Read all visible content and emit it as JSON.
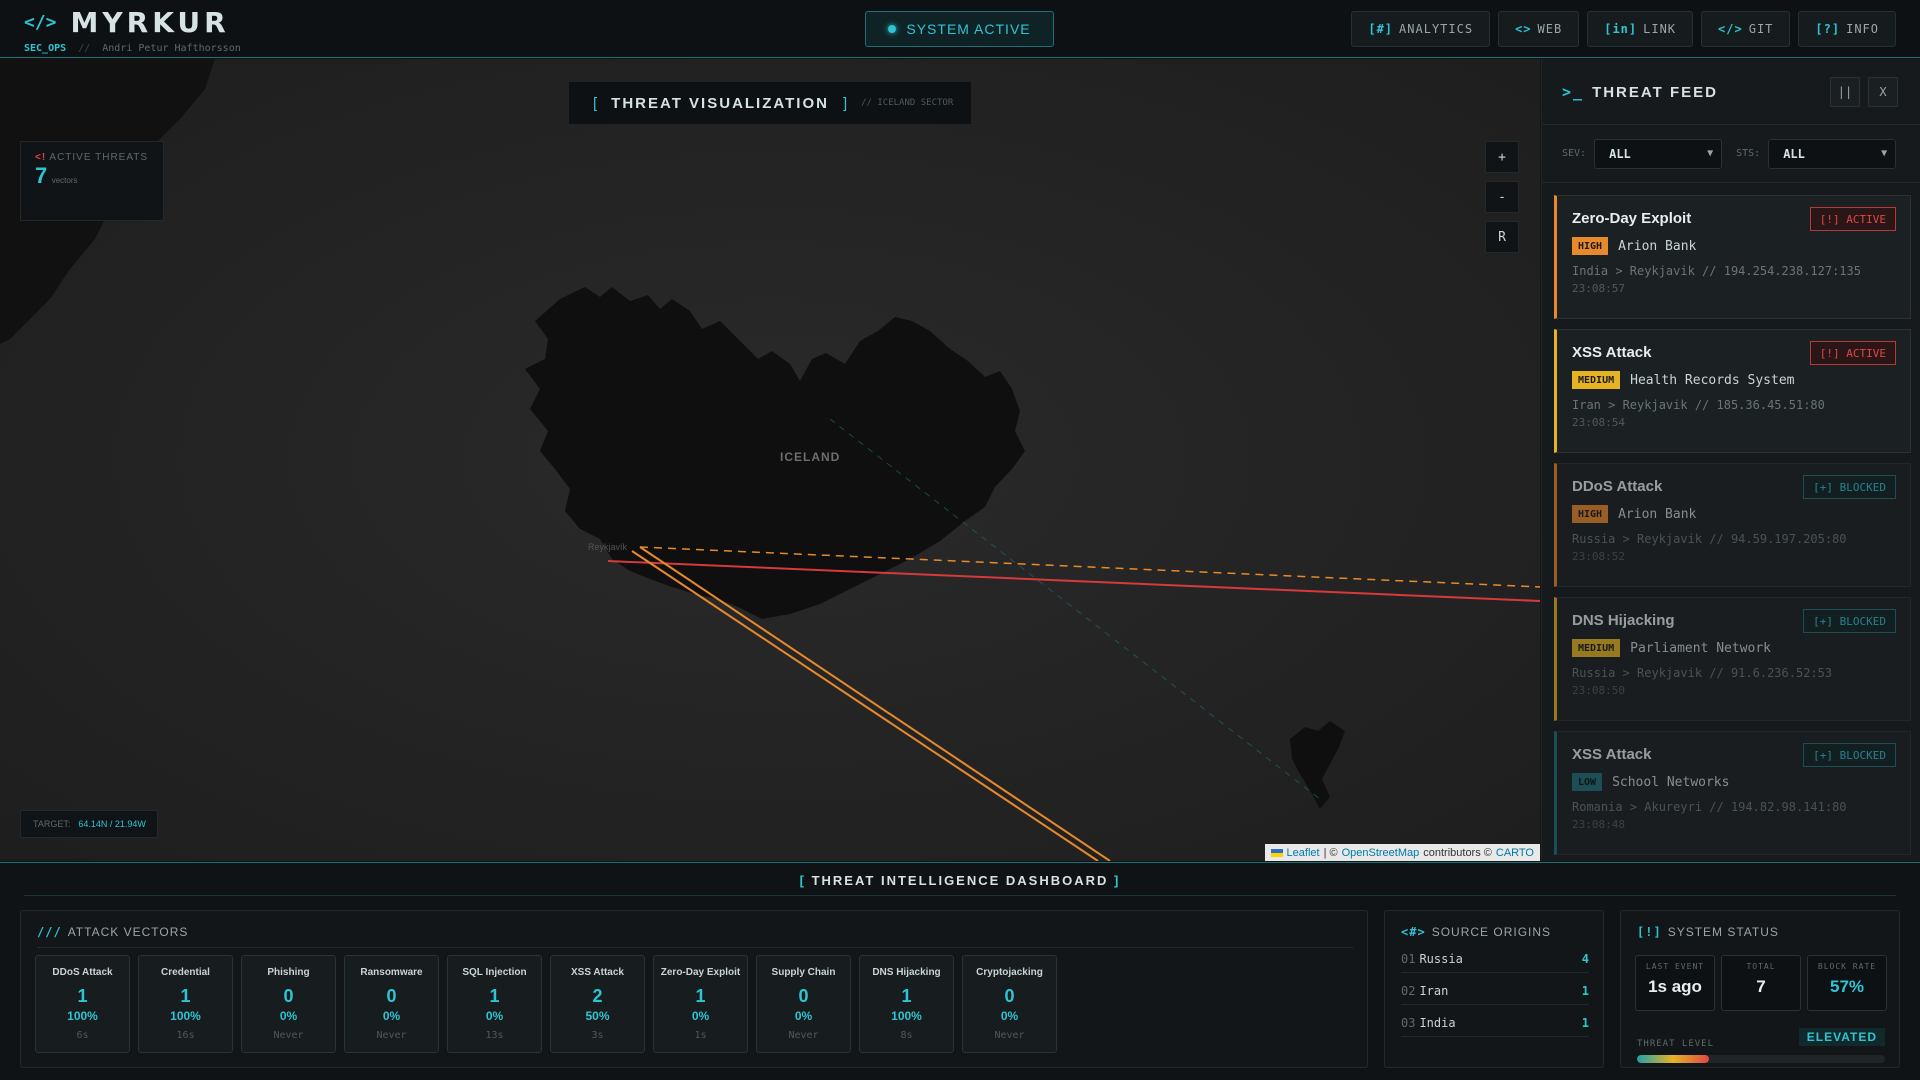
{
  "header": {
    "brand_icon": "</>",
    "brand_name": "MYRKUR",
    "sub_ops": "SEC_OPS",
    "sub_sep": "//",
    "sub_author": "Andri Petur Hafthorsson",
    "status_label": "SYSTEM ACTIVE",
    "nav": [
      {
        "icon": "[#]",
        "label": "ANALYTICS"
      },
      {
        "icon": "<>",
        "label": "WEB"
      },
      {
        "icon": "[in]",
        "label": "LINK"
      },
      {
        "icon": "</>",
        "label": "GIT"
      },
      {
        "icon": "[?]",
        "label": "INFO"
      }
    ]
  },
  "map": {
    "title_left_bracket": "[",
    "title": "THREAT VISUALIZATION",
    "title_right_bracket": "]",
    "title_sub": "// ICELAND SECTOR",
    "active_threats_icon": "<!",
    "active_threats_label": "ACTIVE THREATS",
    "active_threats_value": "7",
    "active_threats_unit": "vectors",
    "zoom_in": "+",
    "zoom_out": "-",
    "reset": "R",
    "target_label": "TARGET:",
    "target_value": "64.14N / 21.94W",
    "country_label": "ICELAND",
    "city_label": "Reykjavík",
    "attribution": {
      "leaflet": "Leaflet",
      "sep": "| ©",
      "osm": "OpenStreetMap",
      "contrib": "contributors ©",
      "carto": "CARTO"
    }
  },
  "feed": {
    "prompt": ">_",
    "title": "THREAT FEED",
    "pause": "||",
    "close": "X",
    "sev_label": "SEV:",
    "sev_value": "ALL",
    "sts_label": "STS:",
    "sts_value": "ALL",
    "items": [
      {
        "title": "Zero-Day Exploit",
        "status": "[!] ACTIVE",
        "severity": "HIGH",
        "target": "Arion Bank",
        "route": "India > Reykjavik // 194.254.238.127:135",
        "time": "23:08:57"
      },
      {
        "title": "XSS Attack",
        "status": "[!] ACTIVE",
        "severity": "MEDIUM",
        "target": "Health Records System",
        "route": "Iran > Reykjavik // 185.36.45.51:80",
        "time": "23:08:54"
      },
      {
        "title": "DDoS Attack",
        "status": "[+] BLOCKED",
        "severity": "HIGH",
        "target": "Arion Bank",
        "route": "Russia > Reykjavik // 94.59.197.205:80",
        "time": "23:08:52"
      },
      {
        "title": "DNS Hijacking",
        "status": "[+] BLOCKED",
        "severity": "MEDIUM",
        "target": "Parliament Network",
        "route": "Russia > Reykjavik // 91.6.236.52:53",
        "time": "23:08:50"
      },
      {
        "title": "XSS Attack",
        "status": "[+] BLOCKED",
        "severity": "LOW",
        "target": "School Networks",
        "route": "Romania > Akureyri // 194.82.98.141:80",
        "time": "23:08:48"
      }
    ]
  },
  "dashboard": {
    "title_l": "[",
    "title": "THREAT INTELLIGENCE DASHBOARD",
    "title_r": "]",
    "vectors_icon": "///",
    "vectors_title": "ATTACK VECTORS",
    "vectors": [
      {
        "name": "DDoS Attack",
        "count": "1",
        "pct": "100%",
        "ago": "6s"
      },
      {
        "name": "Credential Stuffing",
        "count": "1",
        "pct": "100%",
        "ago": "16s"
      },
      {
        "name": "Phishing Campaign",
        "count": "0",
        "pct": "0%",
        "ago": "Never"
      },
      {
        "name": "Ransomware",
        "count": "0",
        "pct": "0%",
        "ago": "Never"
      },
      {
        "name": "SQL Injection",
        "count": "1",
        "pct": "0%",
        "ago": "13s"
      },
      {
        "name": "XSS Attack",
        "count": "2",
        "pct": "50%",
        "ago": "3s"
      },
      {
        "name": "Zero-Day Exploit",
        "count": "1",
        "pct": "0%",
        "ago": "1s"
      },
      {
        "name": "Supply Chain Attack",
        "count": "0",
        "pct": "0%",
        "ago": "Never"
      },
      {
        "name": "DNS Hijacking",
        "count": "1",
        "pct": "100%",
        "ago": "8s"
      },
      {
        "name": "Cryptojacking",
        "count": "0",
        "pct": "0%",
        "ago": "Never"
      }
    ],
    "origins_icon": "<#>",
    "origins_title": "SOURCE ORIGINS",
    "origins": [
      {
        "rank": "01",
        "country": "Russia",
        "count": "4"
      },
      {
        "rank": "02",
        "country": "Iran",
        "count": "1"
      },
      {
        "rank": "03",
        "country": "India",
        "count": "1"
      }
    ],
    "status_icon": "[!]",
    "status_title": "SYSTEM STATUS",
    "last_event_label": "LAST EVENT",
    "last_event_value": "1s ago",
    "total_label": "TOTAL",
    "total_value": "7",
    "block_rate_label": "BLOCK RATE",
    "block_rate_value": "57%",
    "threat_level_label": "THREAT LEVEL",
    "threat_level_value": "ELEVATED",
    "threat_level_fill": 0.29
  },
  "colors": {
    "accent": "#2ec4d4",
    "high": "#e8892b",
    "medium": "#e6b422",
    "active": "#e04646"
  }
}
